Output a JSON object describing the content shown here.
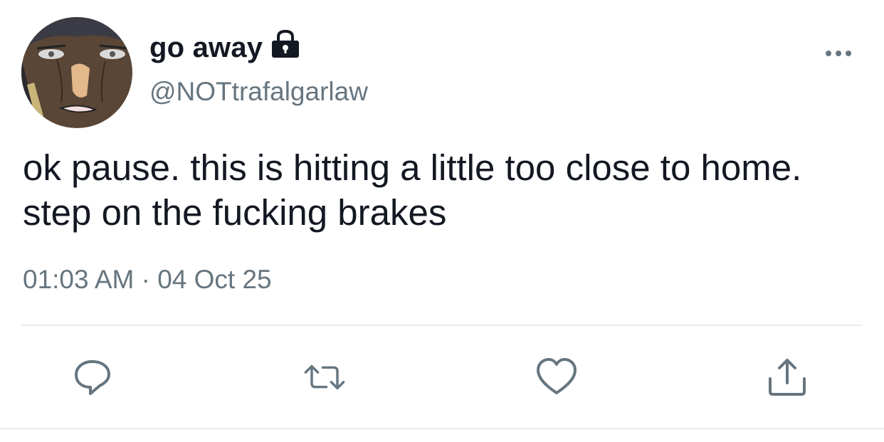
{
  "tweet": {
    "display_name": "go away",
    "handle": "@NOTtrafalgarlaw",
    "protected_icon": "lock-icon",
    "text": "ok pause. this is hitting a little too close to home. step on the fucking brakes",
    "timestamp": "01:03 AM · 04 Oct 25"
  },
  "actions": [
    {
      "name": "reply",
      "icon": "comment-icon"
    },
    {
      "name": "retweet",
      "icon": "retweet-icon"
    },
    {
      "name": "like",
      "icon": "heart-icon"
    },
    {
      "name": "share",
      "icon": "share-icon"
    }
  ],
  "colors": {
    "text_primary": "#141823",
    "text_secondary": "#66757f",
    "icon": "#66757f",
    "divider": "#e6ecf0"
  }
}
